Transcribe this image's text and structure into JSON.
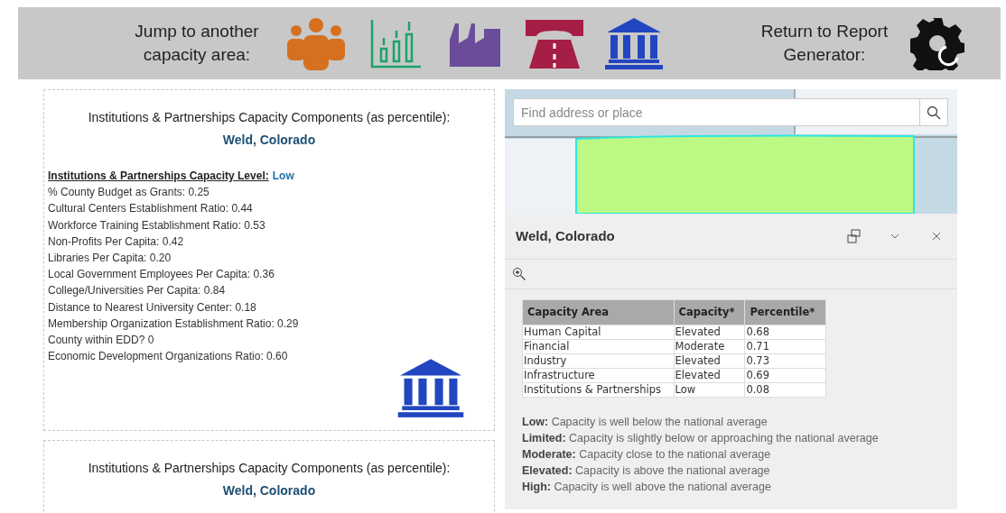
{
  "header": {
    "jump_label": "Jump to another capacity area:",
    "areas": [
      {
        "kind": "people"
      },
      {
        "kind": "chart"
      },
      {
        "kind": "factory"
      },
      {
        "kind": "road"
      },
      {
        "kind": "bank"
      }
    ],
    "return_label": "Return to Report Generator:"
  },
  "cards": [
    {
      "title": "Institutions & Partnerships Capacity Components (as percentile):",
      "county": "Weld, Colorado",
      "level_label": "Institutions & Partnerships Capacity Level:",
      "level_value": "Low",
      "items": [
        "% County Budget as Grants:  0.25",
        "Cultural Centers Establishment Ratio: 0.44",
        "Workforce Training Establishment Ratio: 0.53",
        "Non-Profits Per Capita:  0.42",
        "Libraries Per Capita: 0.20",
        "Local Government Employees Per Capita:  0.36",
        "College/Universities Per Capita: 0.84",
        "Distance to Nearest University Center: 0.18",
        "Membership Organization Establishment Ratio: 0.29",
        "County within EDD? 0",
        "Economic Development Organizations Ratio: 0.60"
      ],
      "kind": "bank"
    },
    {
      "title": "Institutions & Partnerships Capacity Components (as percentile):",
      "county": "Weld, Colorado"
    }
  ],
  "map": {
    "search": {
      "placeholder": "Find address or place"
    }
  },
  "popup": {
    "title": "Weld, Colorado",
    "table": {
      "columns": [
        "Capacity Area",
        "Capacity*",
        "Percentile*"
      ],
      "rows": [
        [
          "Human Capital",
          "Elevated",
          "0.68"
        ],
        [
          "Financial",
          "Moderate",
          "0.71"
        ],
        [
          "Industry",
          "Elevated",
          "0.73"
        ],
        [
          "Infrastructure",
          "Elevated",
          "0.69"
        ],
        [
          "Institutions & Partnerships",
          "Low",
          "0.08"
        ]
      ]
    },
    "legend": [
      "**Low:** Capacity is well below the national average",
      "**Limited:** Capacity is slightly below or approaching the national average",
      "**Moderate:** Capacity close to the national average",
      "**Elevated:** Capacity is above the national average",
      "**High:** Capacity is well above the national average"
    ]
  }
}
